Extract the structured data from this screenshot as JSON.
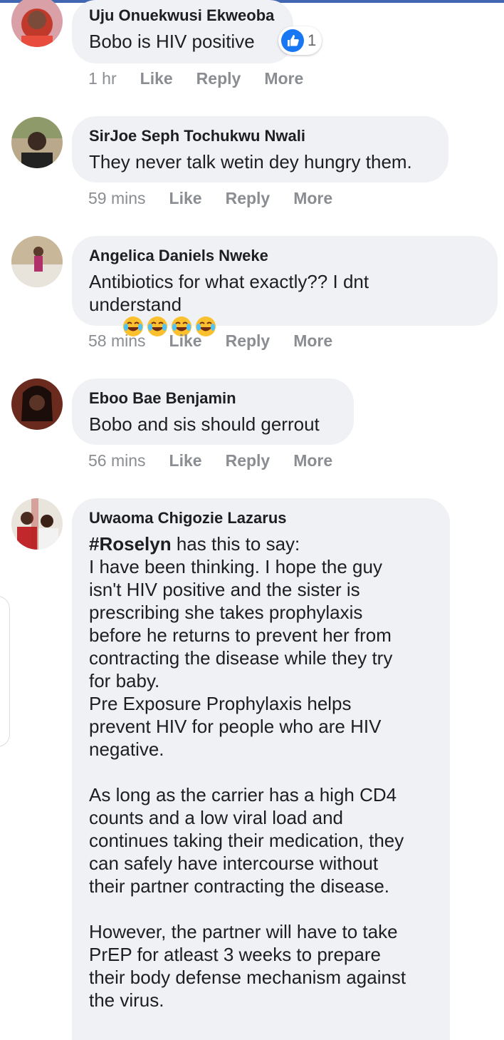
{
  "comments": [
    {
      "author": "Uju Onuekwusi Ekweoba",
      "text": "Bobo is HIV positive",
      "time": "1 hr",
      "like_label": "Like",
      "reply_label": "Reply",
      "more_label": "More",
      "reaction_count": "1"
    },
    {
      "author": "SirJoe Seph Tochukwu Nwali",
      "text": "They never talk wetin dey hungry them.",
      "time": "59 mins",
      "like_label": "Like",
      "reply_label": "Reply",
      "more_label": "More"
    },
    {
      "author": "Angelica Daniels Nweke",
      "text_line1": "Antibiotics for what exactly?? I dnt",
      "text_line2": "understand",
      "emoji": "face-with-tears-of-joy",
      "time": "58 mins",
      "like_label": "Like",
      "reply_label": "Reply",
      "more_label": "More"
    },
    {
      "author": "Eboo Bae Benjamin",
      "text": "Bobo and sis should gerrout",
      "time": "56 mins",
      "like_label": "Like",
      "reply_label": "Reply",
      "more_label": "More"
    },
    {
      "author": "Uwaoma Chigozie Lazarus",
      "hashtag": "#Roselyn",
      "hashtag_rest": " has this to say:",
      "body": "I have been thinking. I hope the guy\nisn't HIV positive and the sister is\nprescribing she takes prophylaxis\nbefore he returns to prevent her from\ncontracting the disease while they try\nfor baby.\nPre Exposure Prophylaxis helps\nprevent HIV for people who are HIV\nnegative.\n\nAs long as the carrier has a high CD4\ncounts and a low viral load and\ncontinues taking their medication, they\ncan safely have intercourse without\ntheir partner contracting the disease.\n\nHowever, the partner will have to take\nPrEP for atleast 3 weeks to prepare\ntheir body defense mechanism against\nthe virus."
    }
  ],
  "colors": {
    "bubble": "#eff1f4",
    "meta_gray": "#8a8d91",
    "like_blue": "#1877f2",
    "top_bar": "#4267b2"
  },
  "icons": {
    "reaction": "thumbs-up-icon",
    "emoji": "face-with-tears-of-joy"
  }
}
